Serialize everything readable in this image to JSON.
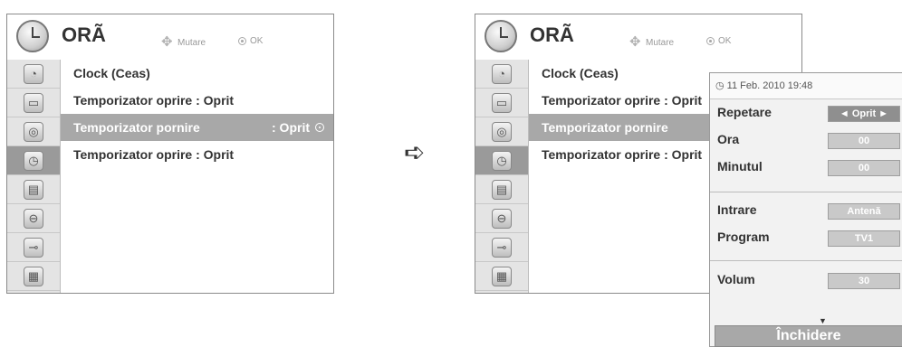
{
  "title": "ORÃ",
  "hints": {
    "move": "Mutare",
    "ok": "OK"
  },
  "icons": [
    "satellite-icon",
    "monitor-icon",
    "speaker-icon",
    "clock-icon",
    "briefcase-icon",
    "lock-icon",
    "input-plug-icon",
    "clapperboard-icon"
  ],
  "left_menu": [
    {
      "label": "Clock (Ceas)"
    },
    {
      "label": "Temporizator oprire  : Oprit"
    },
    {
      "label": "Temporizator pornire",
      "value": ": Oprit"
    },
    {
      "label": "Temporizator oprire  : Oprit"
    }
  ],
  "right_menu": [
    {
      "label": "Clock (Ceas)"
    },
    {
      "label": "Temporizator oprire  : Oprit"
    },
    {
      "label": "Temporizator pornire"
    },
    {
      "label": "Temporizator oprire  : Oprit"
    }
  ],
  "transition_arrow": "➪",
  "popup": {
    "datetime": "11 Feb. 2010 19:48",
    "repeat_label": "Repetare",
    "repeat_value": "◄ Oprit ►",
    "hour_label": "Ora",
    "hour_value": "00",
    "minute_label": "Minutul",
    "minute_value": "00",
    "input_label": "Intrare",
    "input_value": "Antenă",
    "program_label": "Program",
    "program_value": "TV1",
    "volume_label": "Volum",
    "volume_value": "30",
    "more_indicator": "▼",
    "close_label": "Închidere"
  }
}
